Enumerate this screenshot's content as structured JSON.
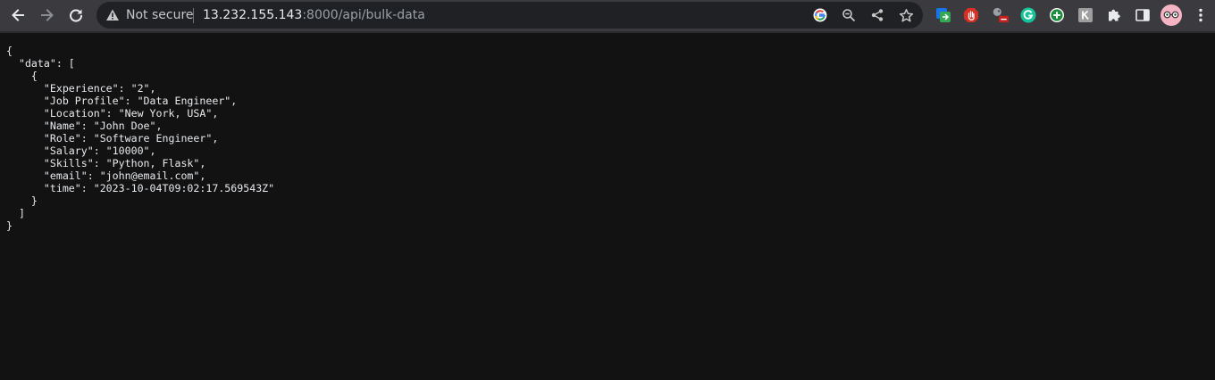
{
  "browser": {
    "security_label": "Not secure",
    "url_host": "13.232.155.143",
    "url_rest": ":8000/api/bulk-data",
    "icons": {
      "back": "back-arrow-icon",
      "forward": "forward-arrow-icon",
      "reload": "reload-icon",
      "warning": "warning-triangle-icon",
      "google": "google-icon",
      "zoom": "zoom-out-icon",
      "share": "share-icon",
      "bookmark": "star-icon",
      "extensions": "puzzle-icon",
      "side_panel": "side-panel-icon",
      "menu": "kebab-menu-icon",
      "profile": "avatar"
    }
  },
  "json_lines": [
    "{",
    "  \"data\": [",
    "    {",
    "      \"Experience\": \"2\",",
    "      \"Job Profile\": \"Data Engineer\",",
    "      \"Location\": \"New York, USA\",",
    "      \"Name\": \"John Doe\",",
    "      \"Role\": \"Software Engineer\",",
    "      \"Salary\": \"10000\",",
    "      \"Skills\": \"Python, Flask\",",
    "      \"email\": \"john@email.com\",",
    "      \"time\": \"2023-10-04T09:02:17.569543Z\"",
    "    }",
    "  ]",
    "}"
  ]
}
